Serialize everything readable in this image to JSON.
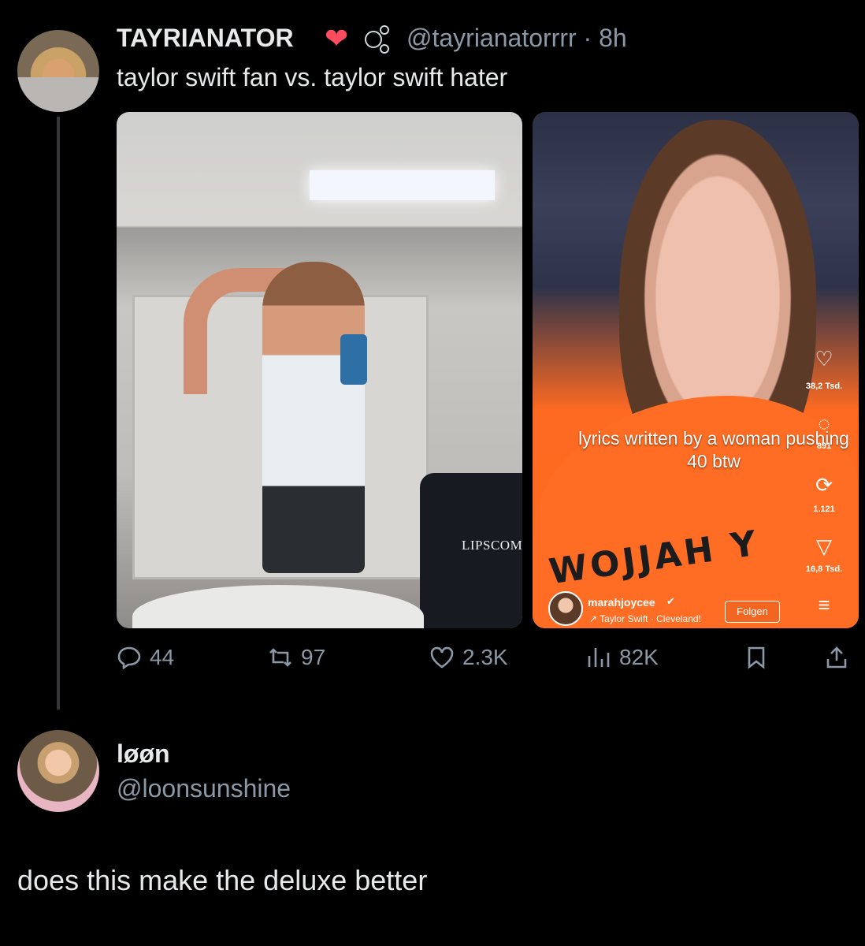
{
  "original_post": {
    "display_name": "TAYRIANATOR",
    "badge_icons": [
      "heart-on-fire-icon",
      "bubbles-icon"
    ],
    "handle": "@tayrianatorrrr",
    "separator": "·",
    "time": "8h",
    "text": "taylor swift fan vs. taylor swift hater",
    "media": {
      "left_image": {
        "watermark": "LIPSCOM"
      },
      "right_image": {
        "caption": "lyrics written by a woman pushing 40 btw",
        "shirt_text": "WOJJAH Y",
        "likes": "38,2 Tsd.",
        "comments": "891",
        "reposts": "1.121",
        "shares": "16,8 Tsd.",
        "username": "marahjoycee",
        "sound": "Taylor Swift · Cleveland!",
        "follow_label": "Folgen"
      }
    },
    "actions": {
      "reply_count": "44",
      "repost_count": "97",
      "like_count": "2.3K",
      "view_count": "82K"
    }
  },
  "reply": {
    "display_name": "løøn",
    "handle": "@loonsunshine",
    "text": "does this make the deluxe better"
  },
  "colors": {
    "background": "#000000",
    "primary_text": "#e7e9ea",
    "secondary_text": "#8b98a5",
    "thread_line": "#333639"
  }
}
